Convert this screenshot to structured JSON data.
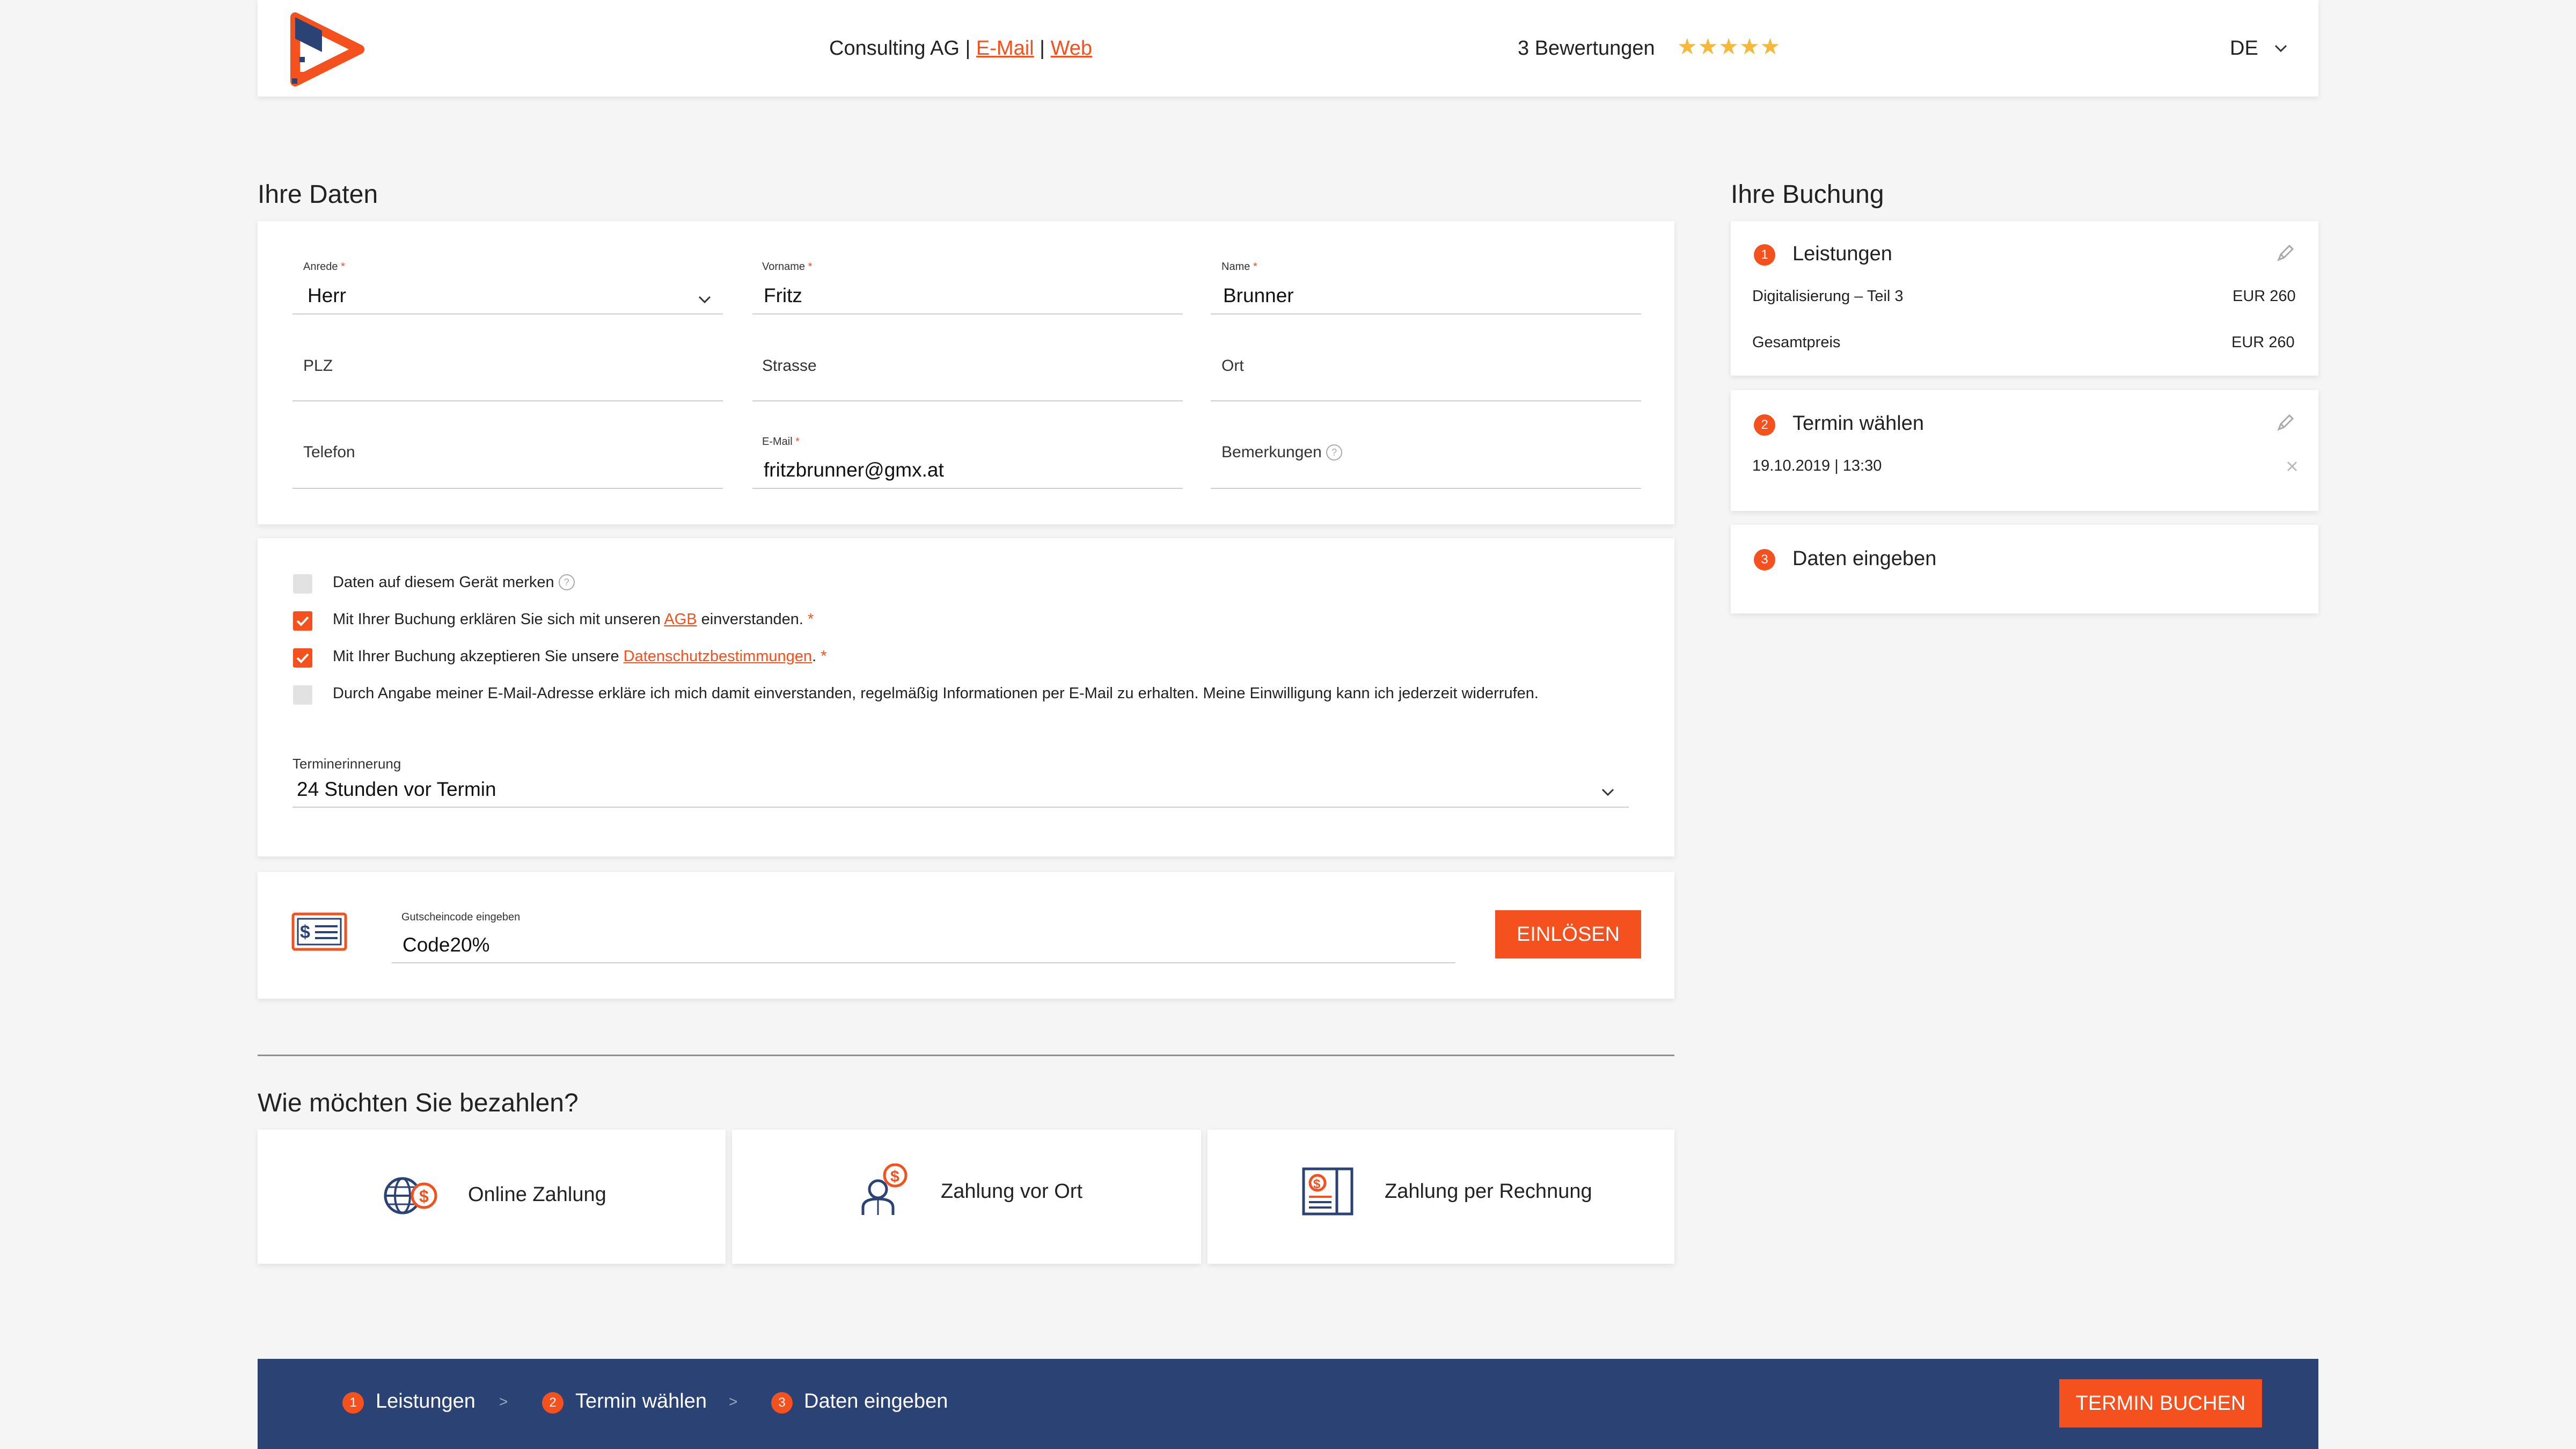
{
  "header": {
    "company_name": "Consulting AG",
    "sep": "|",
    "email_link": "E-Mail",
    "web_link": "Web",
    "reviews_text": "3 Bewertungen",
    "stars": "★★★★★",
    "rating": 4.5,
    "language": "DE"
  },
  "personal": {
    "title": "Ihre Daten",
    "salutation": {
      "label": "Anrede",
      "value": "Herr"
    },
    "firstname": {
      "label": "Vorname",
      "value": "Fritz"
    },
    "lastname": {
      "label": "Name",
      "value": "Brunner"
    },
    "zip": {
      "placeholder": "PLZ"
    },
    "street": {
      "placeholder": "Strasse"
    },
    "city": {
      "placeholder": "Ort"
    },
    "phone": {
      "placeholder": "Telefon"
    },
    "email": {
      "label": "E-Mail",
      "value": "fritzbrunner@gmx.at"
    },
    "notes": {
      "placeholder": "Bemerkungen"
    },
    "required_mark": "*"
  },
  "consents": {
    "remember": {
      "text": "Daten auf diesem Gerät merken",
      "checked": false
    },
    "agb": {
      "before": "Mit Ihrer Buchung erklären Sie sich mit unseren ",
      "link": "AGB",
      "after": " einverstanden.",
      "checked": true
    },
    "privacy": {
      "before": "Mit Ihrer Buchung akzeptieren Sie unsere ",
      "link": "Datenschutzbestimmungen",
      "after": ".",
      "checked": true
    },
    "newsletter": {
      "text": "Durch Angabe meiner E-Mail-Adresse erkläre ich mich damit einverstanden, regelmäßig Informationen per E-Mail zu erhalten. Meine Einwilligung kann ich jederzeit widerrufen.",
      "checked": false
    },
    "reminder": {
      "label": "Terminerinnerung",
      "value": "24 Stunden vor Termin"
    }
  },
  "voucher": {
    "label": "Gutscheincode eingeben",
    "value": "Code20%",
    "button": "EINLÖSEN"
  },
  "payment": {
    "title": "Wie möchten Sie bezahlen?",
    "options": [
      "Online Zahlung",
      "Zahlung vor Ort",
      "Zahlung per Rechnung"
    ]
  },
  "booking": {
    "title": "Ihre Buchung",
    "step1": {
      "num": "1",
      "title": "Leistungen",
      "item": "Digitalisierung – Teil 3",
      "item_price": "EUR 260",
      "total_label": "Gesamtpreis",
      "total_price": "EUR 260"
    },
    "step2": {
      "num": "2",
      "title": "Termin wählen",
      "datetime": "19.10.2019 | 13:30"
    },
    "step3": {
      "num": "3",
      "title": "Daten eingeben"
    }
  },
  "footer": {
    "steps": [
      {
        "num": "1",
        "label": "Leistungen"
      },
      {
        "num": "2",
        "label": "Termin wählen"
      },
      {
        "num": "3",
        "label": "Daten eingeben"
      }
    ],
    "sep": ">",
    "button": "TERMIN BUCHEN"
  },
  "colors": {
    "accent": "#f4511e",
    "navy": "#2b4374",
    "stars": "#f6b83a"
  }
}
